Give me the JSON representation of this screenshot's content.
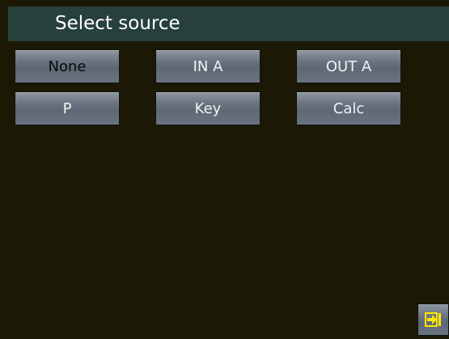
{
  "title": "Select source",
  "buttons": [
    {
      "label": "None",
      "selected": true
    },
    {
      "label": "IN A",
      "selected": false
    },
    {
      "label": "OUT A",
      "selected": false
    },
    {
      "label": "P",
      "selected": false
    },
    {
      "label": "Key",
      "selected": false
    },
    {
      "label": "Calc",
      "selected": false
    }
  ],
  "exit_button": {
    "icon": "exit-arrow-icon",
    "color": "#ffe600"
  },
  "colors": {
    "background": "#1b1906",
    "title_bar": "#28403c",
    "button": "#6e7884",
    "selected_text": "#0a0a0a",
    "button_text": "#f2f2f2"
  }
}
